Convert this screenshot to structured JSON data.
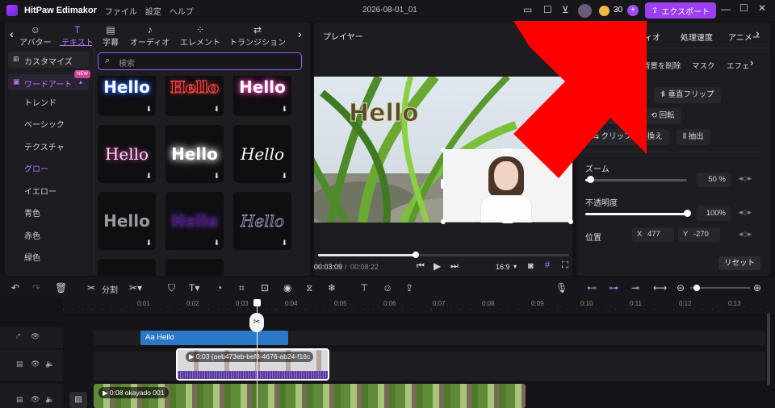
{
  "titlebar": {
    "app_name": "HitPaw Edimakor",
    "menus": [
      "ファイル",
      "設定",
      "ヘルプ"
    ],
    "project_title": "2026-08-01_01",
    "coins": "30",
    "export_label": "エクスポート"
  },
  "media_tabs": [
    {
      "icon": "avatar-icon",
      "label": "アバター"
    },
    {
      "icon": "text-icon",
      "label": "テキスト"
    },
    {
      "icon": "subtitle-icon",
      "label": "字幕"
    },
    {
      "icon": "audio-icon",
      "label": "オーディオ"
    },
    {
      "icon": "elements-icon",
      "label": "エレメント"
    },
    {
      "icon": "transition-icon",
      "label": "トランジション"
    }
  ],
  "text_sidebar": {
    "customize": "カスタマイズ",
    "wordart": "ワードアート",
    "new_badge": "NEW",
    "items": [
      "トレンド",
      "ベーシック",
      "テクスチャ",
      "グロー",
      "イエロー",
      "青色",
      "赤色",
      "緑色"
    ],
    "active_item": "グロー"
  },
  "search": {
    "placeholder": "検索"
  },
  "thumb_text": "Hello",
  "player": {
    "title": "プレイヤー",
    "overlay_text": "Hello",
    "current_time": "00:03:09",
    "total_time": "00:08:22",
    "aspect": "16:9",
    "progress": 0.39
  },
  "right_panel": {
    "tabs": [
      "ディオ",
      "処理速度",
      "アニメー"
    ],
    "subtabs": [
      "背景を削除",
      "マスク",
      "エフェ"
    ],
    "btn_flip_h": "プ",
    "btn_flip_v": "垂直フリップ",
    "btn_rotate_a": "転",
    "btn_rotate": "回転",
    "btn_replace": "クリップ置き換え",
    "btn_extract": "抽出",
    "zoom_label": "ズーム",
    "zoom_value": "50 %",
    "zoom_level": 0.05,
    "opacity_label": "不透明度",
    "opacity_value": "100%",
    "opacity_level": 1.0,
    "position_label": "位置",
    "pos_x_label": "X",
    "pos_x": "477",
    "pos_y_label": "Y",
    "pos_y": "-270",
    "reset_label": "リセット"
  },
  "toolbar": {
    "split_label": "分割"
  },
  "ruler": [
    "0:01",
    "0:02",
    "0:03",
    "0:04",
    "0:05",
    "0:06",
    "0:07",
    "0:08",
    "0:09",
    "0:10",
    "0:11",
    "0:12",
    "0:13"
  ],
  "clips": {
    "text_clip": "Aa Hello",
    "overlay_clip": "0:03 {aeb473eb-bef8-4676-ab24-f16c",
    "main_clip": "0:08 okayado 001"
  },
  "colors": {
    "accent": "#9b3ff0",
    "text_clip": "#2b78c6",
    "overlay_border": "#ffffff",
    "arrow": "#ff0000"
  }
}
